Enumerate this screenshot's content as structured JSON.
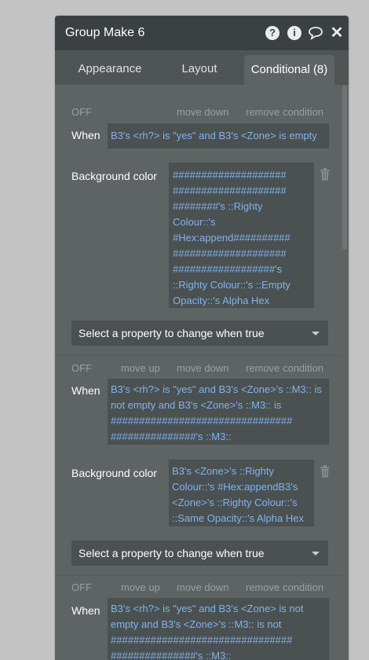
{
  "window": {
    "title": "Group Make 6"
  },
  "tabs": [
    {
      "label": "Appearance"
    },
    {
      "label": "Layout"
    },
    {
      "label": "Conditional (8)"
    }
  ],
  "labels": {
    "off": "OFF",
    "move_up": "move up",
    "move_down": "move down",
    "remove": "remove condition",
    "when": "When",
    "background_color": "Background color",
    "select_property": "Select a property to change when true"
  },
  "conditions": [
    {
      "when_lines": [
        "B3's <rh?> is \"yes\" and B3's <Zone> is empty"
      ],
      "bg_lines": [
        "####################",
        "####################",
        "########'s ::Righty",
        "Colour::'s",
        "#Hex:append##########",
        "####################",
        "##################'s",
        "::Righty Colour::'s ::Empty",
        "Opacity::'s Alpha Hex"
      ]
    },
    {
      "when_lines": [
        "B3's <rh?> is \"yes\" and B3's <Zone>'s ::M3:: is",
        "not empty and B3's <Zone>'s ::M3:: is",
        "################################",
        "###############'s ::M3::"
      ],
      "bg_lines": [
        "B3's <Zone>'s ::Righty",
        "Colour::'s #Hex:appendB3's",
        "<Zone>'s ::Righty Colour::'s",
        "::Same Opacity::'s Alpha Hex"
      ]
    },
    {
      "when_lines": [
        "B3's <rh?> is \"yes\" and B3's <Zone> is not",
        "empty and B3's <Zone>'s ::M3:: is not",
        "################################",
        "###############'s ::M3::"
      ]
    }
  ]
}
